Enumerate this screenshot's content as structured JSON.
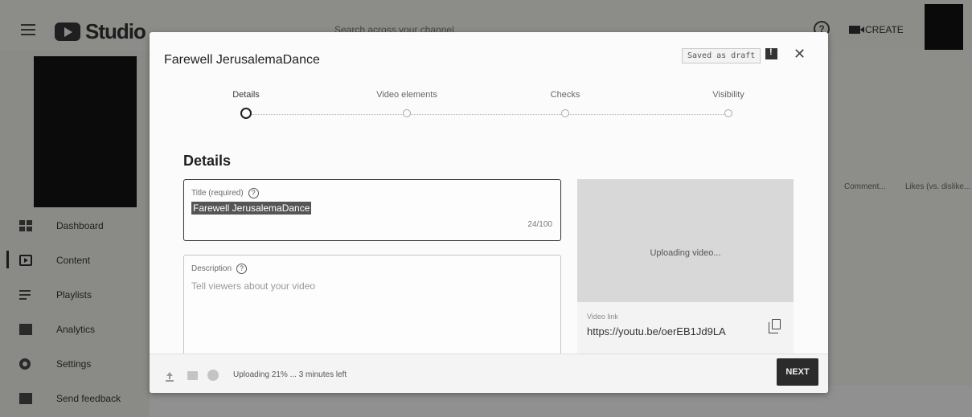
{
  "app": {
    "logo_text": "Studio",
    "search_placeholder": "Search across your channel",
    "help_symbol": "?",
    "create_label": "CREATE"
  },
  "sidebar": {
    "items": [
      {
        "label": "Dashboard",
        "icon": "dashboard-icon"
      },
      {
        "label": "Content",
        "icon": "content-icon",
        "active": true
      },
      {
        "label": "Playlists",
        "icon": "playlists-icon"
      },
      {
        "label": "Analytics",
        "icon": "analytics-icon"
      },
      {
        "label": "Settings",
        "icon": "settings-icon"
      },
      {
        "label": "Send feedback",
        "icon": "feedback-icon"
      }
    ]
  },
  "background": {
    "columns": [
      "Comment...",
      "Likes (vs. dislike..."
    ]
  },
  "modal": {
    "title": "Farewell JerusalemaDance",
    "saved_badge": "Saved as draft",
    "close_symbol": "✕",
    "steps": [
      {
        "label": "Details",
        "current": true
      },
      {
        "label": "Video elements",
        "current": false
      },
      {
        "label": "Checks",
        "current": false
      },
      {
        "label": "Visibility",
        "current": false
      }
    ],
    "section_title": "Details",
    "title_field": {
      "label": "Title (required)",
      "value": "Farewell JerusalemaDance",
      "counter": "24/100"
    },
    "description_field": {
      "label": "Description",
      "placeholder": "Tell viewers about your video"
    },
    "preview": {
      "status": "Uploading video...",
      "link_label": "Video link",
      "link_value": "https://youtu.be/oerEB1Jd9LA"
    },
    "footer": {
      "upload_status": "Uploading 21% ... 3 minutes left",
      "upload_progress_percent": 21,
      "next_label": "NEXT"
    }
  },
  "colors": {
    "dim_overlay": "#8c8c89",
    "modal_bg": "#fbfbfb",
    "next_button": "#2b2b2b"
  }
}
